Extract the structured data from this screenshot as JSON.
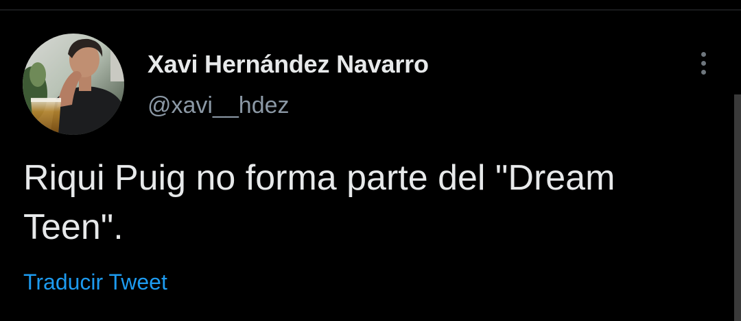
{
  "tweet": {
    "author": {
      "display_name": "Xavi Hernández Navarro",
      "handle": "@xavi__hdez"
    },
    "text": "Riqui Puig no forma parte del \"Dream Teen\".",
    "translate_label": "Traducir Tweet"
  },
  "icons": {
    "more": "more-options-icon",
    "avatar": "profile-photo"
  },
  "colors": {
    "background": "#000000",
    "text_primary": "#e7e9ea",
    "text_secondary": "#8b98a5",
    "link": "#1d9bf0"
  }
}
